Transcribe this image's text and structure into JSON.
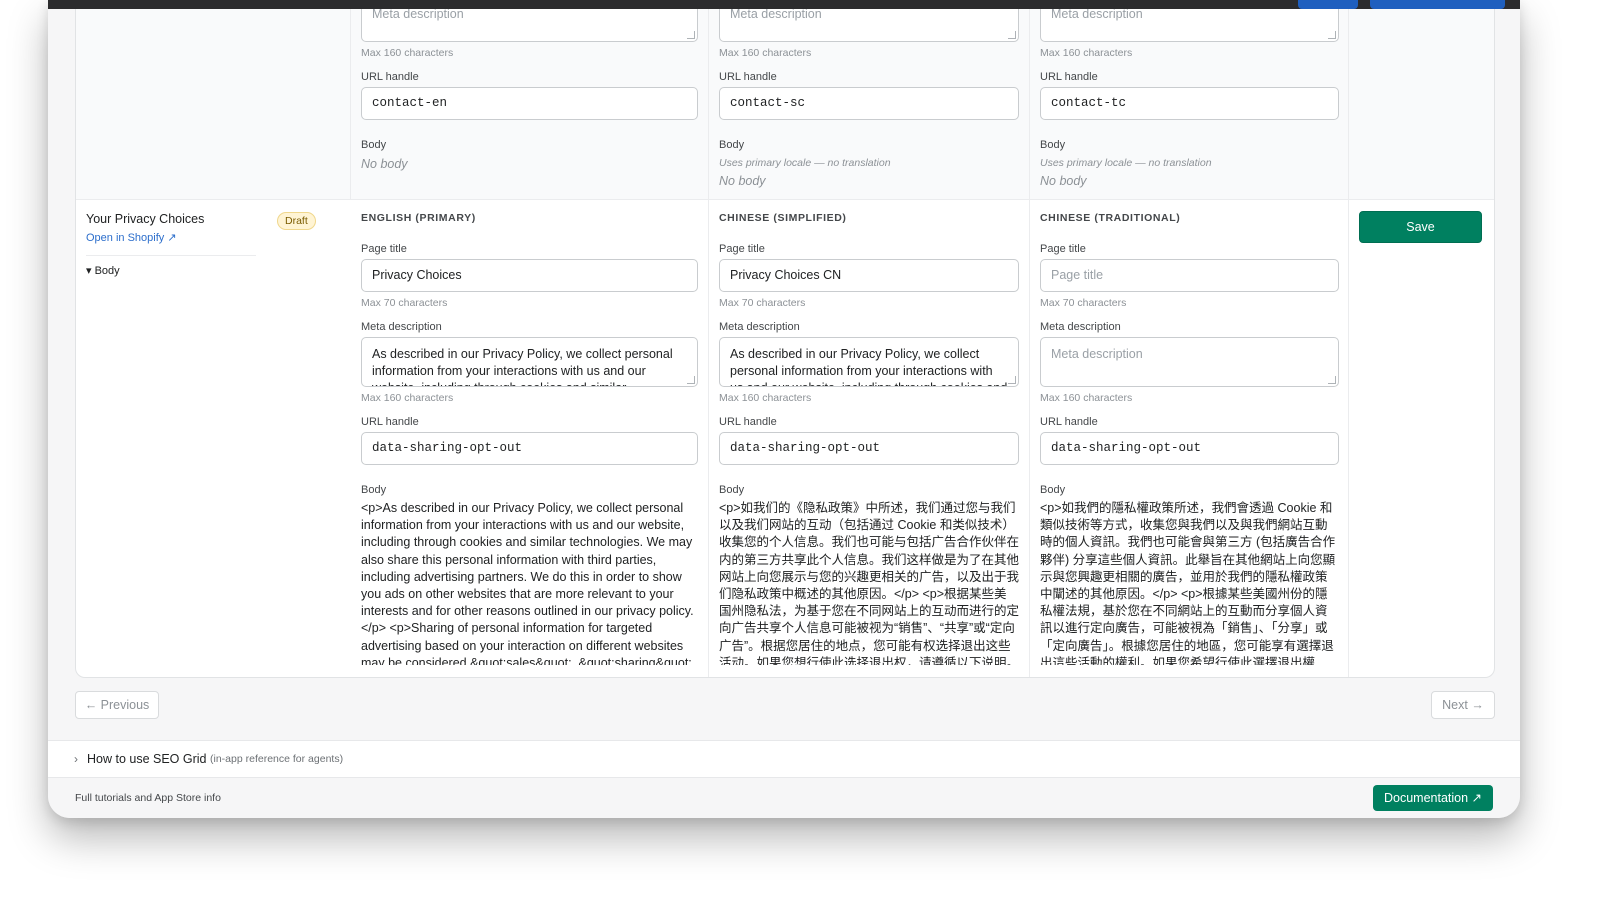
{
  "top_rows": {
    "col1": {
      "meta_placeholder": "Meta description",
      "meta_hint": "Max 160 characters",
      "url_label": "URL handle",
      "url_value": "contact-en",
      "body_label": "Body",
      "body_value": "No body"
    },
    "col2": {
      "meta_placeholder": "Meta description",
      "meta_hint": "Max 160 characters",
      "url_label": "URL handle",
      "url_value": "contact-sc",
      "body_label": "Body",
      "body_note": "Uses primary locale — no translation",
      "body_value": "No body"
    },
    "col3": {
      "meta_placeholder": "Meta description",
      "meta_hint": "Max 160 characters",
      "url_label": "URL handle",
      "url_value": "contact-tc",
      "body_label": "Body",
      "body_note": "Uses primary locale — no translation",
      "body_value": "No body"
    }
  },
  "row": {
    "page_name": "Your Privacy Choices",
    "status_badge": "Draft",
    "open_link": "Open in Shopify ↗",
    "body_toggle": "▾ Body",
    "save_label": "Save",
    "columns": [
      {
        "heading": "ENGLISH (PRIMARY)",
        "page_title_label": "Page title",
        "page_title_value": "Privacy Choices",
        "title_hint": "Max 70 characters",
        "meta_label": "Meta description",
        "meta_value": "As described in our Privacy Policy, we collect personal information from your interactions with us and our website, including through cookies and similar technologies.",
        "meta_hint": "Max 160 characters",
        "url_label": "URL handle",
        "url_value": "data-sharing-opt-out",
        "body_label": "Body",
        "body_value": "<p>As described in our Privacy Policy, we collect personal information from your interactions with us and our website, including through cookies and similar technologies. We may also share this personal information with third parties, including advertising partners. We do this in order to show you ads on other websites that are more relevant to your interests and for other reasons outlined in our privacy policy.</p> <p>Sharing of personal information for targeted advertising based on your interaction on different websites may be considered &quot;sales&quot;, &quot;sharing&quot;,"
      },
      {
        "heading": "CHINESE (SIMPLIFIED)",
        "page_title_label": "Page title",
        "page_title_value": "Privacy Choices CN",
        "title_hint": "Max 70 characters",
        "meta_label": "Meta description",
        "meta_value": "As described in our Privacy Policy, we collect personal information from your interactions with us and our website, including through cookies and similar technologies.",
        "meta_hint": "Max 160 characters",
        "url_label": "URL handle",
        "url_value": "data-sharing-opt-out",
        "body_label": "Body",
        "body_value": "<p>如我们的《隐私政策》中所述，我们通过您与我们以及我们网站的互动（包括通过 Cookie 和类似技术）收集您的个人信息。我们也可能与包括广告合作伙伴在内的第三方共享此个人信息。我们这样做是为了在其他网站上向您展示与您的兴趣更相关的广告，以及出于我们隐私政策中概述的其他原因。</p> <p>根据某些美国州隐私法，为基于您在不同网站上的互动而进行的定向广告共享个人信息可能被视为“销售”、“共享”或“定向广告”。根据您居住的地点，您可能有权选择退出这些活动。如果您想行使此选择退出权，请遵循以下说明。</p> <p>如果您在自"
      },
      {
        "heading": "CHINESE (TRADITIONAL)",
        "page_title_label": "Page title",
        "page_title_value": "Page title",
        "title_hint": "Max 70 characters",
        "meta_label": "Meta description",
        "meta_value": "Meta description",
        "meta_hint": "Max 160 characters",
        "url_label": "URL handle",
        "url_value": "data-sharing-opt-out",
        "body_label": "Body",
        "body_value": "<p>如我們的隱私權政策所述，我們會透過 Cookie 和類似技術等方式，收集您與我們以及與我們網站互動時的個人資訊。我們也可能會與第三方 (包括廣告合作夥伴) 分享這些個人資訊。此舉旨在其他網站上向您顯示與您興趣更相關的廣告，並用於我們的隱私權政策中闡述的其他原因。</p> <p>根據某些美國州份的隱私權法規，基於您在不同網站上的互動而分享個人資訊以進行定向廣告，可能被視為「銷售」、「分享」或「定向廣告」。根據您居住的地區，您可能享有選擇退出這些活動的權利。如果您希望行使此選擇退出權利，請遵循以下說明。</p> <p>如"
      }
    ]
  },
  "pagination": {
    "previous": "← Previous",
    "next": "Next →"
  },
  "help": {
    "chevron": "›",
    "title": "How to use SEO Grid",
    "subtitle": "(in-app reference for agents)"
  },
  "footer": {
    "text": "Full tutorials and App Store info",
    "doc_button": "Documentation ↗"
  },
  "colors": {
    "accent": "#008060",
    "link": "#2c6ecb",
    "draft_badge": "#fff4d4"
  }
}
